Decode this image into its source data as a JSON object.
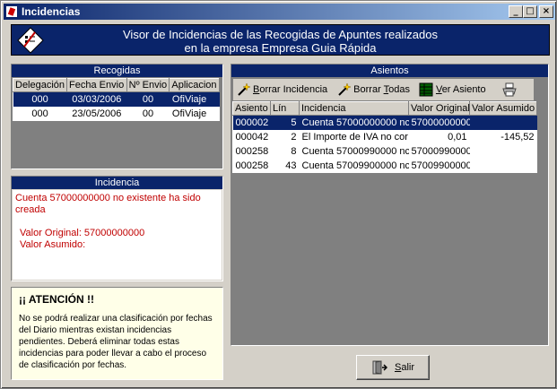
{
  "window": {
    "title": "Incidencias"
  },
  "titlebar_buttons": {
    "minimize": "_",
    "maximize": "□",
    "close": "×"
  },
  "header": {
    "line1": "Visor de Incidencias de las Recogidas de Apuntes realizados",
    "line2": "en la empresa Empresa Guia Rápida"
  },
  "recogidas": {
    "title": "Recogidas",
    "columns": [
      "Delegación",
      "Fecha Envio",
      "Nº Envio",
      "Aplicacion"
    ],
    "rows": [
      [
        "000",
        "03/03/2006",
        "00",
        "OfiViaje"
      ],
      [
        "000",
        "23/05/2006",
        "00",
        "OfiViaje"
      ]
    ]
  },
  "incidencia": {
    "title": "Incidencia",
    "line1": "Cuenta 57000000000 no existente ha sido",
    "line2": "creada",
    "valor_original": "Valor Original: 57000000000",
    "valor_asumido": "Valor Asumido:"
  },
  "atencion": {
    "title": "¡¡ ATENCIÓN !!",
    "text": "No se podrá realizar una clasificación por fechas del Diario mientras existan incidencias pendientes. Deberá eliminar todas estas incidencias para poder llevar a cabo el proceso de clasificación por fechas."
  },
  "asientos": {
    "title": "Asientos",
    "toolbar": {
      "borrar_incidencia_pre": "",
      "borrar_incidencia_u": "B",
      "borrar_incidencia_post": "orrar Incidencia",
      "borrar_todas_pre": "Borrar ",
      "borrar_todas_u": "T",
      "borrar_todas_post": "odas",
      "ver_asiento_pre": "",
      "ver_asiento_u": "V",
      "ver_asiento_post": "er Asiento"
    },
    "columns": [
      "Asiento",
      "Lín",
      "Incidencia",
      "Valor Original",
      "Valor Asumido"
    ],
    "rows": [
      [
        "000002",
        "5",
        "Cuenta 57000000000 nc",
        "57000000000",
        ""
      ],
      [
        "000042",
        "2",
        "El Importe de IVA no cor",
        "0,01",
        "-145,52"
      ],
      [
        "000258",
        "8",
        "Cuenta 57000990000 nc",
        "57000990000",
        ""
      ],
      [
        "000258",
        "43",
        "Cuenta 57009900000 nc",
        "57009900000",
        ""
      ]
    ]
  },
  "salir": {
    "label_u": "S",
    "label_post": "alir"
  }
}
